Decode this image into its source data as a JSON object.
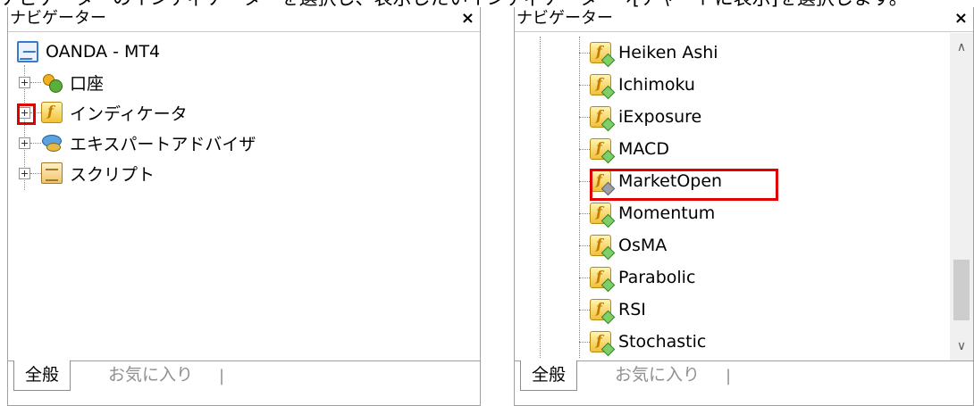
{
  "caption": "ナビゲーターのインディケーターを選択し、表示したいインディケーター→[チャートに表示]を選択します。",
  "left_panel": {
    "title": "ナビゲーター",
    "close_glyph": "×",
    "tree": {
      "root_label": "OANDA - MT4",
      "items": [
        {
          "label": "口座",
          "icon": "accounts-icon"
        },
        {
          "label": "インディケータ",
          "icon": "indicator-icon"
        },
        {
          "label": "エキスパートアドバイザ",
          "icon": "expert-advisor-icon"
        },
        {
          "label": "スクリプト",
          "icon": "script-icon"
        }
      ]
    },
    "tabs": {
      "active": "全般",
      "inactive": "お気に入り",
      "separator": "|"
    }
  },
  "right_panel": {
    "title": "ナビゲーター",
    "close_glyph": "×",
    "indicators": [
      {
        "label": "Heiken Ashi"
      },
      {
        "label": "Ichimoku"
      },
      {
        "label": "iExposure"
      },
      {
        "label": "MACD"
      },
      {
        "label": "MarketOpen",
        "highlighted": true
      },
      {
        "label": "Momentum"
      },
      {
        "label": "OsMA"
      },
      {
        "label": "Parabolic"
      },
      {
        "label": "RSI"
      },
      {
        "label": "Stochastic"
      }
    ],
    "scrollbar": {
      "up_glyph": "∧",
      "down_glyph": "∨"
    },
    "tabs": {
      "active": "全般",
      "inactive": "お気に入り",
      "separator": "|"
    }
  },
  "colors": {
    "highlight": "#e00000",
    "border": "#a0a0a0",
    "inactive_text": "#909090"
  }
}
